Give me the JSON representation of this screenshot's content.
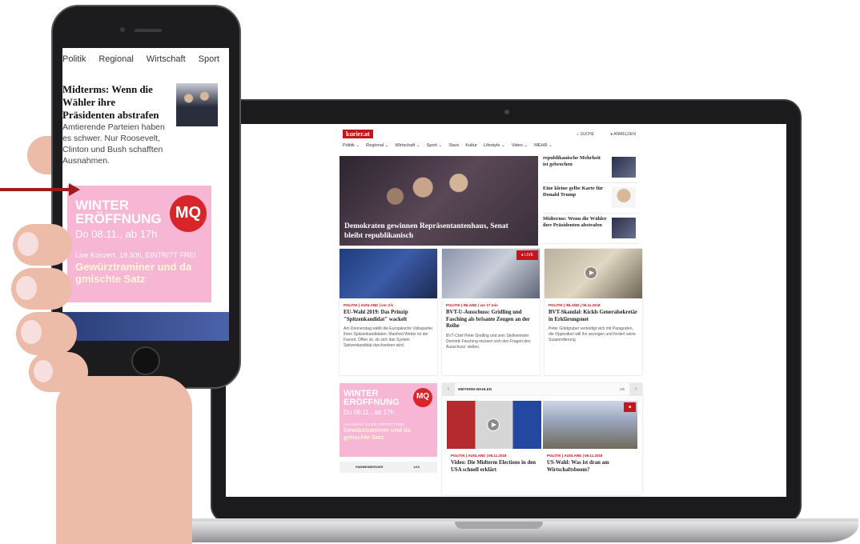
{
  "laptop": {
    "site": {
      "logo": "kurier.at",
      "search_label": "SUCHE",
      "login_label": "ANMELDEN",
      "nav": [
        "Politik ⌄",
        "Regional ⌄",
        "Wirtschaft ⌄",
        "Sport ⌄",
        "Stars",
        "Kultur",
        "Lifestyle ⌄",
        "Video ⌄",
        "MEHR ⌄"
      ],
      "hero_caption": "Demokraten gewinnen Repräsentantenhaus, Senat bleibt republikanisch",
      "side_items": [
        "republikanische Mehrheit ist gebrochen",
        "Eine kleine gelbe Karte für Donald Trump",
        "Midterms: Wenn die Wähler ihre Präsidenten abstrafen"
      ],
      "cards": [
        {
          "meta": "POLITIK | AUSLAND | vor 3 h",
          "title": "EU-Wahl 2019: Das Prinzip \"Spitzenkandidat\" wackelt",
          "text": "Am Donnerstag wählt die Europäische Volkspartei ihren Spitzenkandidaten. Manfred Weber ist der Favorit. Offen ist, ob sich das System Spitzenkandidat durchsetzen wird."
        },
        {
          "meta": "POLITIK | INLAND | vor 17 min",
          "title": "BVT-U-Ausschuss: Gridling und Fasching als brisante Zeugen an der Reihe",
          "text": "BVT-Chef Peter Gridling und sein Stellvertreter Dominik Fasching müssen sich den Fragen des Ausschuss' stellen.",
          "badge": "LIVE"
        },
        {
          "meta": "POLITIK | INLAND | 06.11.2018",
          "title": "BVT-Skandal: Kickls Generalsekretär in Erklärungsnot",
          "text": "Peter Goldgruber verteidigt sich mit Paragrafen, die Opposition will ihn anzeigen und fordert seine Suspendierung"
        }
      ],
      "ad": {
        "line1": "WINTER",
        "line2": "ERÖFFNUNG",
        "line3": "Do 08.11., ab 17h",
        "line4": "Live Konzert, 19.30h, EINTRITT FREI",
        "line5": "Gewürztraminer und da gmischte Satz",
        "logo": "MQ"
      },
      "video_section": {
        "heading": "MIDTERM-WAHLEN",
        "counter": "1/5",
        "videos": [
          {
            "meta": "POLITIK | AUSLAND | 06.11.2018",
            "title": "Video: Die Midterm Elections in den USA schnell erklärt"
          },
          {
            "meta": "POLITIK | AUSLAND | 06.11.2018",
            "title": "US-Wahl: Was ist dran am Wirtschaftsboom?"
          }
        ]
      },
      "ticker": {
        "label": "PAMMESBERGER",
        "counter": "1/10"
      }
    }
  },
  "phone": {
    "nav": [
      "Politik",
      "Regional",
      "Wirtschaft",
      "Sport"
    ],
    "headline": "Midterms: Wenn die Wähler ihre Präsidenten abstrafen",
    "text": "Amtierende Parteien haben es schwer. Nur Roosevelt, Clinton und Bush schafften Ausnahmen.",
    "ad": {
      "line1": "WINTER",
      "line2": "ERÖFFNUNG",
      "line3": "Do 08.11., ab 17h",
      "line4": "Live Konzert, 19.30h, EINTRITT FREI",
      "line5": "Gewürztraminer und da gmischte Satz",
      "logo": "MQ"
    }
  },
  "colors": {
    "brand_red": "#c4161c",
    "ad_pink": "#f7b6d3",
    "arrow": "#9b1c1c"
  }
}
